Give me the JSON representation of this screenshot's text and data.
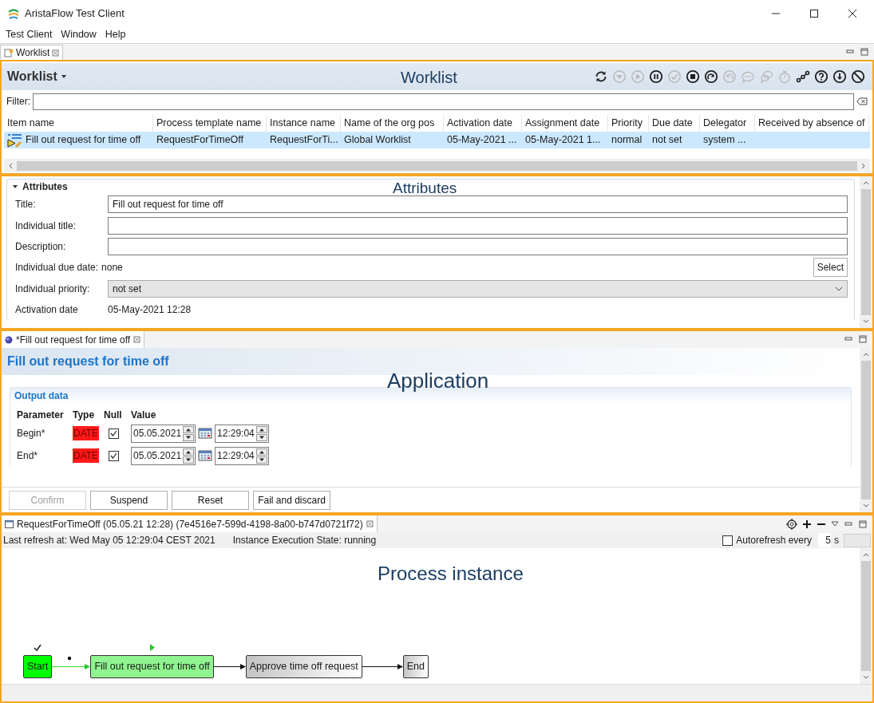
{
  "window": {
    "title": "AristaFlow Test Client"
  },
  "menu": [
    "Test Client",
    "Window",
    "Help"
  ],
  "view_tabs": [
    {
      "label": "Worklist",
      "selected": true
    }
  ],
  "worklist": {
    "callout": "Worklist",
    "title": "Worklist",
    "toolbar": [
      {
        "kind": "refresh",
        "disabled": false
      },
      {
        "kind": "down",
        "disabled": true
      },
      {
        "kind": "play",
        "disabled": true
      },
      {
        "kind": "pause",
        "disabled": false
      },
      {
        "kind": "check",
        "disabled": true
      },
      {
        "kind": "stop",
        "disabled": false
      },
      {
        "kind": "redo",
        "disabled": false
      },
      {
        "kind": "undo",
        "disabled": true
      },
      {
        "kind": "comment",
        "disabled": true
      },
      {
        "kind": "comments",
        "disabled": true
      },
      {
        "kind": "stopwatch",
        "disabled": true
      },
      {
        "kind": "graph",
        "disabled": false
      },
      {
        "kind": "help",
        "disabled": false
      },
      {
        "kind": "download",
        "disabled": false
      },
      {
        "kind": "cancel",
        "disabled": false
      }
    ],
    "filter": {
      "label": "Filter:"
    },
    "columns": [
      "Item name",
      "Process template name",
      "Instance name",
      "Name of the org pos",
      "Activation date",
      "Assignment date",
      "Priority",
      "Due date",
      "Delegator",
      "Received by absence of"
    ],
    "rows": [
      {
        "selected": true,
        "cells": [
          "Fill out request for time off",
          "RequestForTimeOff",
          "RequestForTi...",
          "Global Worklist",
          "05-May-2021 ...",
          "05-May-2021 1...",
          "normal",
          "not set",
          "system ..."
        ]
      }
    ]
  },
  "attributes": {
    "callout": "Attributes",
    "heading": "Attributes",
    "expanded": true,
    "fields": [
      {
        "kind": "text",
        "label": "Title:",
        "value": "Fill out request for time off"
      },
      {
        "kind": "text",
        "label": "Individual title:"
      },
      {
        "kind": "text",
        "label": "Description:"
      },
      {
        "kind": "value_button",
        "label": "Individual due date:",
        "value": "none",
        "button": "Select"
      },
      {
        "kind": "dropdown",
        "label": "Individual priority:",
        "value": "not set"
      },
      {
        "kind": "plain",
        "label": "Activation date",
        "value": "05-May-2021 12:28"
      }
    ]
  },
  "application": {
    "tab": {
      "label": "*Fill out request for time off"
    },
    "callout": "Application",
    "title": "Fill out request for time off",
    "section": "Output data",
    "columns": [
      "Parameter",
      "Type",
      "Null",
      "Value"
    ],
    "rows": [
      {
        "parameter": "Begin*",
        "type": "DATE",
        "null": true,
        "date": "05.05.2021",
        "time": "12:29:04"
      },
      {
        "parameter": "End*",
        "type": "DATE",
        "null": true,
        "date": "05.05.2021",
        "time": "12:29:04"
      }
    ],
    "buttons": [
      {
        "label": "Confirm",
        "disabled": true
      },
      {
        "label": "Suspend",
        "disabled": false
      },
      {
        "label": "Reset",
        "disabled": false
      },
      {
        "label": "Fail and discard",
        "disabled": false
      }
    ]
  },
  "process": {
    "tab": {
      "label": "RequestForTimeOff (05.05.21 12:28) (7e4516e7-599d-4198-8a00-b747d0721f72)"
    },
    "last_refresh": "Last refresh at: Wed May 05 12:29:04 CEST 2021",
    "state": "Instance Execution State: running",
    "autorefresh": {
      "label": "Autorefresh every",
      "checked": false,
      "value": "5",
      "unit": "s"
    },
    "callout": "Process instance",
    "nodes": [
      {
        "label": "Start",
        "completed": true,
        "activated": false
      },
      {
        "label": "Fill out request for time off",
        "completed": false,
        "activated": true
      },
      {
        "label": "Approve time off request",
        "completed": false,
        "activated": false
      },
      {
        "label": "End",
        "completed": false,
        "activated": false
      }
    ],
    "edges": [
      {
        "signaled": true
      },
      {
        "signaled": false
      },
      {
        "signaled": false
      }
    ]
  }
}
